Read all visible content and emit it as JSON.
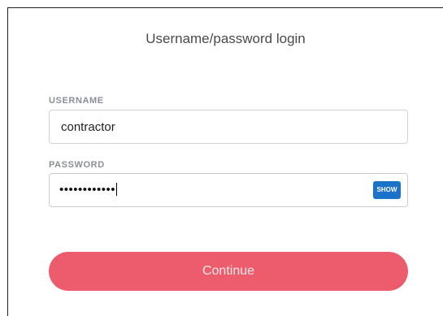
{
  "login": {
    "title": "Username/password login",
    "username": {
      "label": "USERNAME",
      "value": "contractor"
    },
    "password": {
      "label": "PASSWORD",
      "masked_value": "••••••••••••",
      "show_label": "SHOW"
    },
    "continue_label": "Continue"
  },
  "colors": {
    "continue_button": "#ec5c6c",
    "show_button": "#1a72c9",
    "label_text": "#8a8f96"
  }
}
